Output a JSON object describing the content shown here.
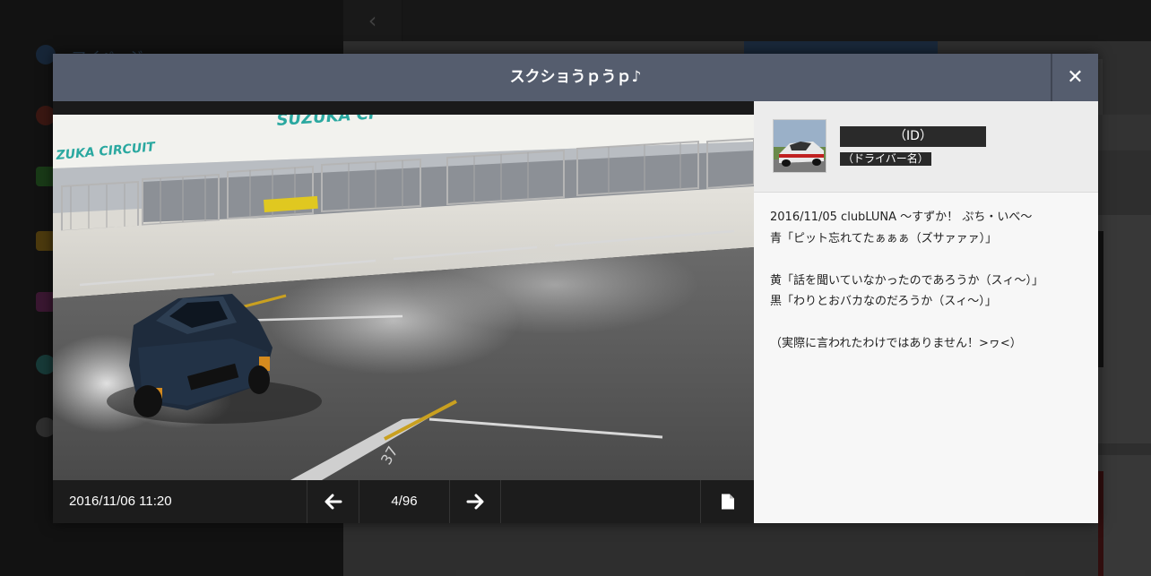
{
  "background": {
    "sidebar_label": "マイページ"
  },
  "modal": {
    "title": "スクショうｐうｐ♪",
    "close_icon": "close-icon"
  },
  "viewer": {
    "date": "2016/11/06 11:20",
    "counter": "4/96",
    "prev_icon": "arrow-left-icon",
    "next_icon": "arrow-right-icon",
    "file_icon": "file-icon"
  },
  "photo_text": {
    "sign_top": "SUZUKA CI",
    "sign_side": "ZUKA CIRCUIT",
    "pit_number": "37"
  },
  "profile": {
    "user_id": "（ID）",
    "driver_name": "（ドライバー名）"
  },
  "comment": {
    "lines": [
      "2016/11/05 clubLUNA 〜すずか！ ぷち・いべ〜",
      "青「ピット忘れてたぁぁぁ（ズサァァァ）」",
      "",
      "黄「話を聞いていなかったのであろうか（スィ〜）」",
      "黒「わりとおバカなのだろうか（スィ〜）」",
      "",
      "（実際に言われたわけではありません！>ヮ<）"
    ]
  },
  "colors": {
    "header": "#555d6e",
    "accent": "#2e4a6a"
  }
}
